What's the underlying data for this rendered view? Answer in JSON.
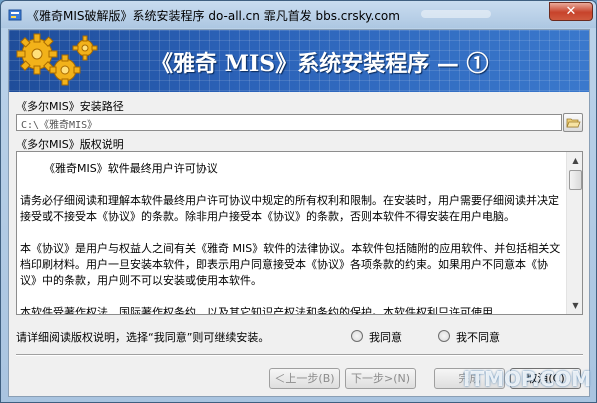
{
  "window": {
    "title": "《雅奇MIS破解版》系统安装程序 do-all.cn  霏凡首发 bbs.crsky.com",
    "close_label": "✕"
  },
  "banner": {
    "title": "《雅奇 MIS》系统安装程序 — ①"
  },
  "install_path": {
    "label": "《多尔MIS》安装路径",
    "value": "C:\\《雅奇MIS》",
    "browse_icon": "folder-open-icon"
  },
  "license": {
    "label": "《多尔MIS》版权说明",
    "title": "《雅奇MIS》软件最终用户许可协议",
    "paragraphs": [
      "请务必仔细阅读和理解本软件最终用户许可协议中规定的所有权利和限制。在安装时，用户需要仔细阅读并决定接受或不接受本《协议》的条款。除非用户接受本《协议》的条款，否则本软件不得安装在用户电脑。",
      "本《协议》是用户与权益人之间有关《雅奇 MIS》软件的法律协议。本软件包括随附的应用软件、并包括相关文档印刷材料。用户一旦安装本软件，即表示用户同意接受本《协议》各项条款的约束。如果用户不同意本《协议》中的条款，用户则不可以安装或使用本软件。",
      "本软件受著作权法、国际著作权条约、以及其它知识产权法和条约的保护。本软件权利只许可使用"
    ]
  },
  "agreement": {
    "prompt": "请详细阅读版权说明，选择“我同意”则可继续安装。",
    "agree_label": "我同意",
    "disagree_label": "我不同意"
  },
  "buttons": {
    "back": "＜上一步(B)",
    "next": "下一步>(N)",
    "finish": "完成",
    "cancel": "取消(C)"
  },
  "watermark": "ITMOP.COM",
  "colors": {
    "banner": "#2b62b8",
    "close": "#c7432b"
  }
}
